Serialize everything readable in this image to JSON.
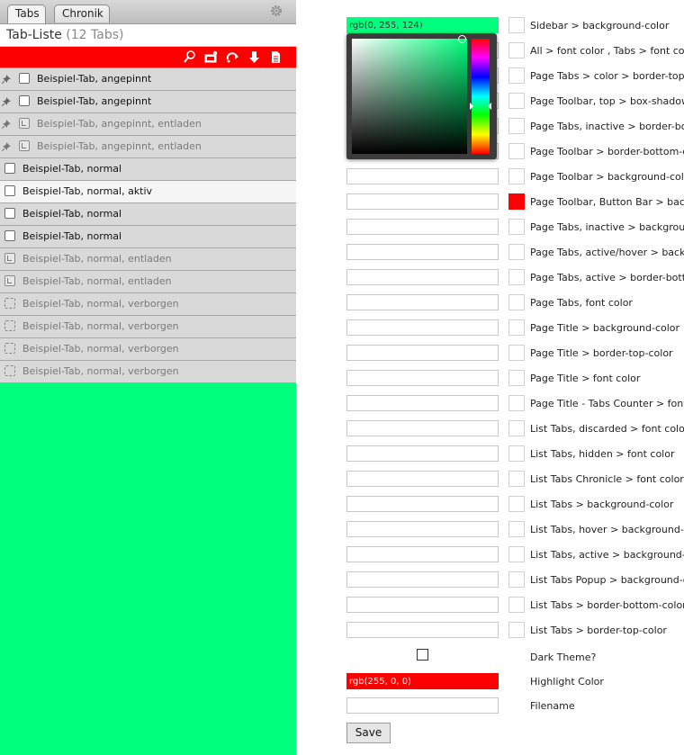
{
  "sidebar": {
    "tabs": [
      "Tabs",
      "Chronik"
    ],
    "title": "Tab-Liste",
    "title_count": "(12 Tabs)",
    "toolbar_bg": "#ff0000",
    "sidebar_bg": "#00ff7c",
    "toolbar_icons": [
      "search-icon",
      "new-window-icon",
      "reload-icon",
      "unload-icon",
      "document-icon"
    ],
    "items": [
      {
        "label": "Beispiel-Tab, angepinnt",
        "state": "pinned"
      },
      {
        "label": "Beispiel-Tab, angepinnt",
        "state": "pinned"
      },
      {
        "label": "Beispiel-Tab, angepinnt, entladen",
        "state": "pinned-discarded"
      },
      {
        "label": "Beispiel-Tab, angepinnt, entladen",
        "state": "pinned-discarded"
      },
      {
        "label": "Beispiel-Tab, normal",
        "state": "normal"
      },
      {
        "label": "Beispiel-Tab, normal, aktiv",
        "state": "active"
      },
      {
        "label": "Beispiel-Tab, normal",
        "state": "normal"
      },
      {
        "label": "Beispiel-Tab, normal",
        "state": "normal"
      },
      {
        "label": "Beispiel-Tab, normal, entladen",
        "state": "discarded"
      },
      {
        "label": "Beispiel-Tab, normal, entladen",
        "state": "discarded"
      },
      {
        "label": "Beispiel-Tab, normal, verborgen",
        "state": "hidden"
      },
      {
        "label": "Beispiel-Tab, normal, verborgen",
        "state": "hidden"
      },
      {
        "label": "Beispiel-Tab, normal, verborgen",
        "state": "hidden"
      },
      {
        "label": "Beispiel-Tab, normal, verborgen",
        "state": "hidden"
      }
    ]
  },
  "form": {
    "rows": [
      {
        "label": "Sidebar > background-color",
        "value": "rgb(0, 255, 124)",
        "color": "#00ff7c"
      },
      {
        "label": "All > font color , Tabs > font colo",
        "value": "",
        "color": ""
      },
      {
        "label": "Page Tabs > color > border-top ,",
        "value": "",
        "color": ""
      },
      {
        "label": "Page Toolbar, top > box-shadow",
        "value": "",
        "color": ""
      },
      {
        "label": "Page Tabs, inactive > border-bott",
        "value": "",
        "color": ""
      },
      {
        "label": "Page Toolbar > border-bottom-co",
        "value": "",
        "color": ""
      },
      {
        "label": "Page Toolbar > background-color",
        "value": "",
        "color": ""
      },
      {
        "label": "Page Toolbar, Button Bar > backg",
        "value": "",
        "color": "#ff0000"
      },
      {
        "label": "Page Tabs, inactive > background",
        "value": "",
        "color": ""
      },
      {
        "label": "Page Tabs, active/hover > backgro",
        "value": "",
        "color": ""
      },
      {
        "label": "Page Tabs, active > border-bottor",
        "value": "",
        "color": ""
      },
      {
        "label": "Page Tabs, font color",
        "value": "",
        "color": ""
      },
      {
        "label": "Page Title > background-color",
        "value": "",
        "color": ""
      },
      {
        "label": "Page Title > border-top-color",
        "value": "",
        "color": ""
      },
      {
        "label": "Page Title > font color",
        "value": "",
        "color": ""
      },
      {
        "label": "Page Title - Tabs Counter > font c",
        "value": "",
        "color": ""
      },
      {
        "label": "List Tabs, discarded > font color",
        "value": "",
        "color": ""
      },
      {
        "label": "List Tabs, hidden > font color",
        "value": "",
        "color": ""
      },
      {
        "label": "List Tabs Chronicle > font color",
        "value": "",
        "color": ""
      },
      {
        "label": "List Tabs > background-color",
        "value": "",
        "color": ""
      },
      {
        "label": "List Tabs, hover > background-co",
        "value": "",
        "color": ""
      },
      {
        "label": "List Tabs, active > background-co",
        "value": "",
        "color": ""
      },
      {
        "label": "List Tabs Popup > background-co",
        "value": "",
        "color": ""
      },
      {
        "label": "List Tabs > border-bottom-color",
        "value": "",
        "color": ""
      },
      {
        "label": "List Tabs > border-top-color",
        "value": "",
        "color": ""
      }
    ],
    "dark_theme_label": "Dark Theme?",
    "highlight_label": "Highlight Color",
    "highlight_value": "rgb(255, 0, 0)",
    "highlight_color": "#ff0000",
    "filename_label": "Filename",
    "filename_value": "",
    "save_label": "Save"
  }
}
